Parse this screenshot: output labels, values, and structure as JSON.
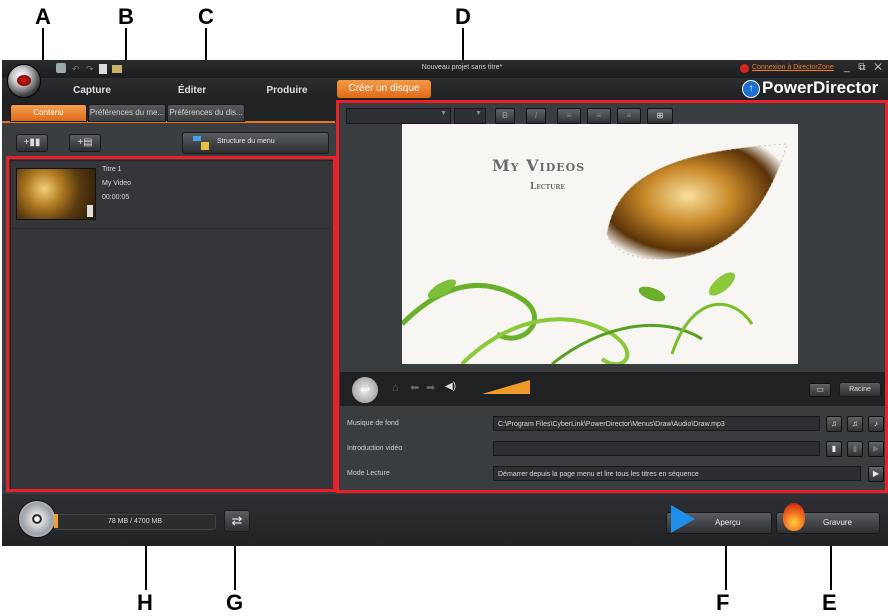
{
  "callouts": {
    "a": "A",
    "b": "B",
    "c": "C",
    "d": "D",
    "e": "E",
    "f": "F",
    "g": "G",
    "h": "H"
  },
  "window": {
    "title": "Nouveau projet sans titre*",
    "login_link": "Connexion à DirectorZone",
    "brand": "PowerDirector",
    "controls": "_ ⧉ ✕"
  },
  "menu": {
    "capture": "Capture",
    "edit": "Éditer",
    "produce": "Produire",
    "create_disc": "Créer un disque"
  },
  "tabs": {
    "content": "Contenu",
    "menu_prefs": "Préférences du me...",
    "disc_prefs": "Préférences du dis..."
  },
  "left": {
    "menu_structure_label": "Structure du menu",
    "item": {
      "title": "Titre 1",
      "name": "My Video",
      "duration": "00:00:05"
    }
  },
  "preview": {
    "title_text": "My Videos",
    "subtitle_text": "Lecture",
    "root_button": "Racine"
  },
  "settings": {
    "bg_music_label": "Musique de fond",
    "bg_music_path": "C:\\Program Files\\CyberLink\\PowerDirector\\Menus\\Draw\\Audio\\Draw.mp3",
    "intro_label": "Introduction vidéo",
    "intro_value": "",
    "play_mode_label": "Mode Lecture",
    "play_mode_value": "Démarrer depuis la page menu et lire tous les titres en séquence"
  },
  "bottom": {
    "disc_usage": "78 MB / 4700 MB",
    "preview_button": "Aperçu",
    "burn_button": "Gravure"
  },
  "colors": {
    "accent_orange": "#e8751f",
    "highlight_red": "#e8202a",
    "panel": "#3b3e41",
    "brand_blue": "#1e6fd0"
  },
  "icons": [
    "app-logo-icon",
    "undo-icon",
    "redo-icon",
    "new-icon",
    "open-icon",
    "home-icon",
    "back-icon",
    "forward-icon",
    "volume-icon",
    "disc-icon",
    "swap-icon",
    "play-icon",
    "fire-icon"
  ]
}
